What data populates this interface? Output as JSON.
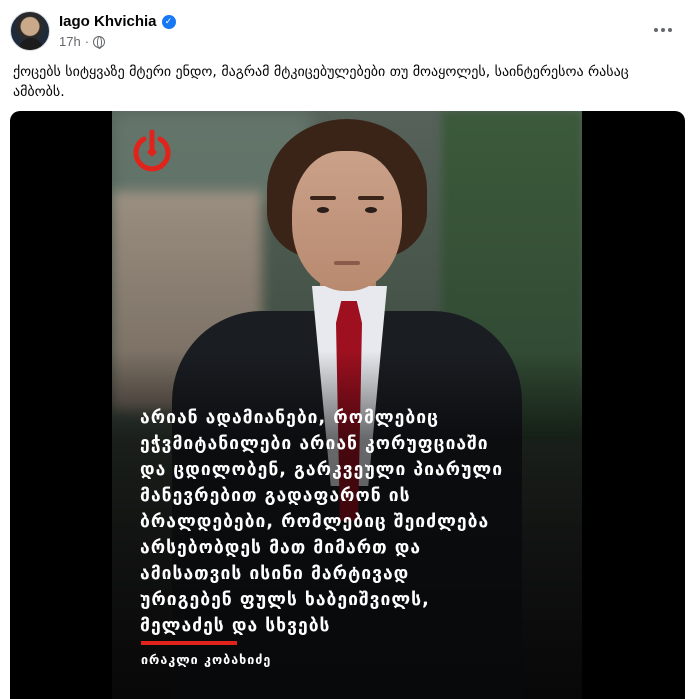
{
  "post": {
    "author": "Iago Khvichia",
    "time": "17h",
    "caption": "ქოცებს სიტყვაზე მტერი ენდო, მაგრამ მტკიცებულებები თუ მოაყოლეს, საინტერესოა რასაც ამბობს."
  },
  "media": {
    "quote": "არიან ადამიანები, რომლებიც\nეჭვმიტანილები არიან კორუფციაში\nდა ცდილობენ, გარკვეული პიარული\nმანევრებით გადაფარონ ის\nბრალდებები, რომლებიც შეიძლება\nარსებობდეს მათ მიმართ და\nამისათვის ისინი მარტივად\nურიგებენ ფულს ხაბეიშვილს,\nმელაძეს და სხვებს",
    "attribution": "ირაკლი კობახიძე"
  },
  "colors": {
    "verified": "#1877f2",
    "accent_red": "#e0241b",
    "meta_gray": "#65676b"
  }
}
